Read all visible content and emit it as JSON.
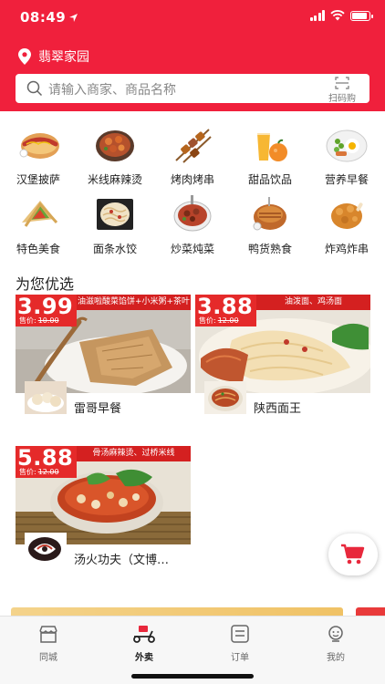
{
  "status_bar": {
    "time": "08:49"
  },
  "header": {
    "location": "翡翠家园",
    "search_placeholder": "请输入商家、商品名称",
    "scan_label": "扫码购"
  },
  "categories": [
    {
      "label": "汉堡披萨",
      "icon": "hamburger-pizza-icon"
    },
    {
      "label": "米线麻辣烫",
      "icon": "rice-noodle-icon"
    },
    {
      "label": "烤肉烤串",
      "icon": "skewer-icon"
    },
    {
      "label": "甜品饮品",
      "icon": "dessert-drink-icon"
    },
    {
      "label": "营养早餐",
      "icon": "breakfast-icon"
    },
    {
      "label": "特色美食",
      "icon": "wrap-icon"
    },
    {
      "label": "面条水饺",
      "icon": "noodle-icon"
    },
    {
      "label": "炒菜炖菜",
      "icon": "stew-icon"
    },
    {
      "label": "鸭货熟食",
      "icon": "duck-icon"
    },
    {
      "label": "炸鸡炸串",
      "icon": "fried-chicken-icon"
    }
  ],
  "section_title": "为您优选",
  "stores": [
    {
      "price": "3.99",
      "original_label": "售价:",
      "original_price": "10.00",
      "promo": "油滋啦酸菜馅饼+小米粥+茶叶",
      "name": "雷哥早餐"
    },
    {
      "price": "3.88",
      "original_label": "售价:",
      "original_price": "12.00",
      "promo": "油泼面、鸡汤面",
      "name": "陕西面王"
    },
    {
      "price": "5.88",
      "original_label": "售价:",
      "original_price": "12.00",
      "promo": "骨汤麻辣烫、过桥米线",
      "name": "汤火功夫（文博…"
    }
  ],
  "tabs": [
    {
      "label": "同城",
      "icon": "shop-icon",
      "active": false
    },
    {
      "label": "外卖",
      "icon": "scooter-icon",
      "active": true
    },
    {
      "label": "订单",
      "icon": "order-icon",
      "active": false
    },
    {
      "label": "我的",
      "icon": "profile-icon",
      "active": false
    }
  ],
  "colors": {
    "brand_red": "#f0203c",
    "price_red": "#e52a2a",
    "text": "#222222"
  }
}
